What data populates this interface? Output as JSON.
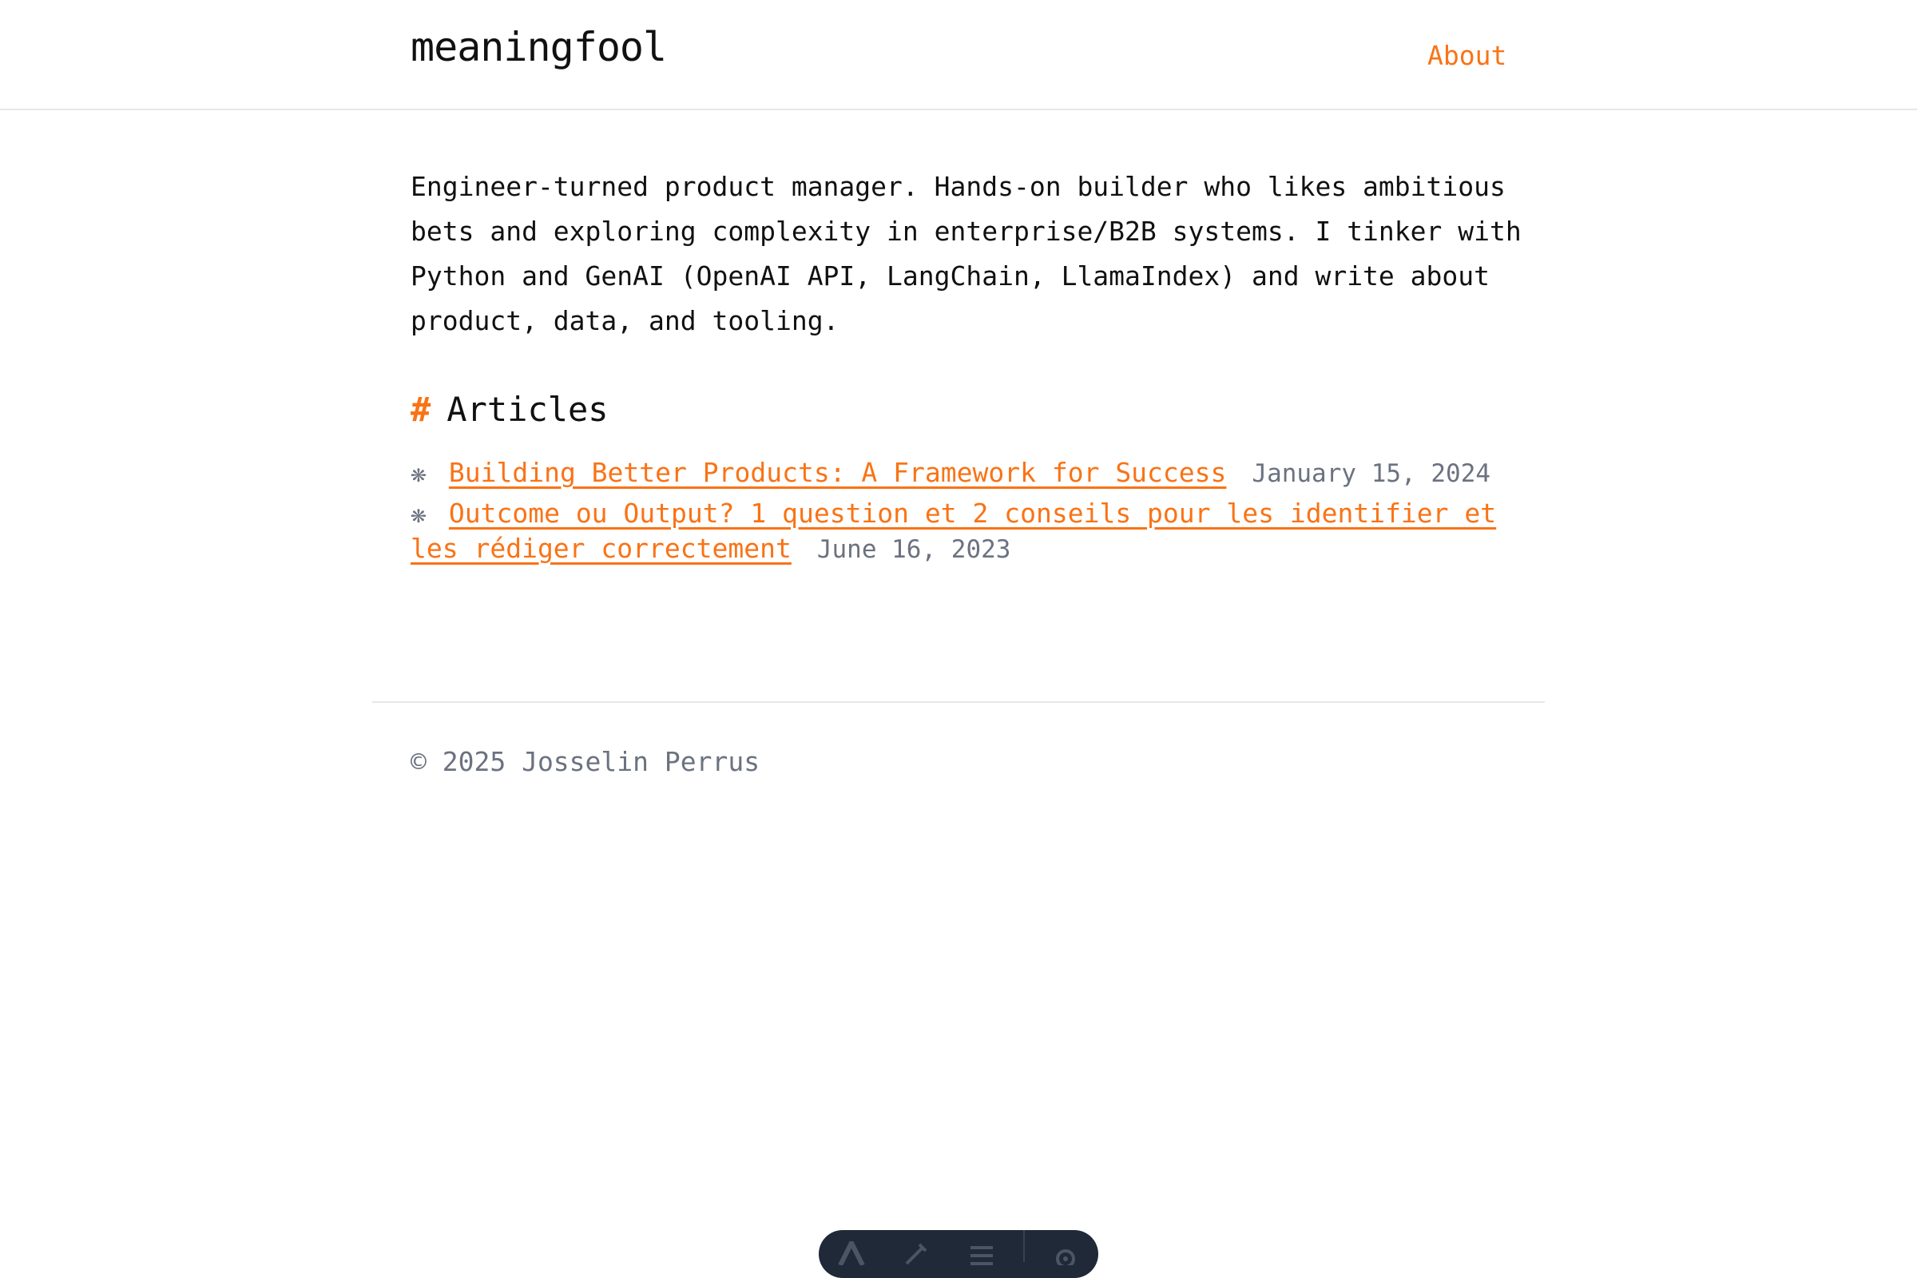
{
  "header": {
    "brand": "meaningfool",
    "nav": {
      "about_label": "About"
    }
  },
  "intro": {
    "text": "Engineer-turned product manager. Hands-on builder who likes ambitious bets and exploring complexity in enterprise/B2B systems. I tinker with Python and GenAI (OpenAI API, LangChain, LlamaIndex) and write about product, data, and tooling."
  },
  "articles": {
    "hash": "#",
    "heading": "Articles",
    "items": [
      {
        "bullet": "❋",
        "title": "Building Better Products: A Framework for Success",
        "date": "January 15, 2024"
      },
      {
        "bullet": "❋",
        "title": "Outcome ou Output? 1 question et 2 conseils pour les identifier et les rédiger correctement",
        "date": "June 16, 2023"
      }
    ]
  },
  "footer": {
    "copyright": "© 2025 Josselin Perrus"
  },
  "toolbar": {
    "icons": [
      "font-icon",
      "brush-icon",
      "menu-icon",
      "gear-icon"
    ],
    "accent_color": "#f97316"
  }
}
